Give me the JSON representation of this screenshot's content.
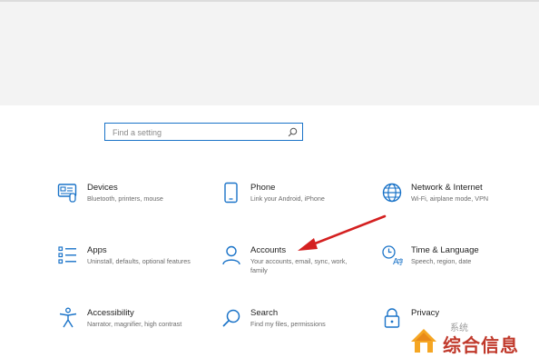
{
  "search": {
    "placeholder": "Find a setting"
  },
  "accent_color": "#1a73c8",
  "annotation_arrow_color": "#d42020",
  "tiles": [
    {
      "icon": "devices-icon",
      "title": "Devices",
      "desc": "Bluetooth, printers, mouse"
    },
    {
      "icon": "phone-icon",
      "title": "Phone",
      "desc": "Link your Android, iPhone"
    },
    {
      "icon": "globe-icon",
      "title": "Network & Internet",
      "desc": "Wi-Fi, airplane mode, VPN"
    },
    {
      "icon": "apps-list-icon",
      "title": "Apps",
      "desc": "Uninstall, defaults, optional features"
    },
    {
      "icon": "person-icon",
      "title": "Accounts",
      "desc": "Your accounts, email, sync, work, family"
    },
    {
      "icon": "time-language-icon",
      "title": "Time & Language",
      "desc": "Speech, region, date"
    },
    {
      "icon": "accessibility-icon",
      "title": "Accessibility",
      "desc": "Narrator, magnifier, high contrast"
    },
    {
      "icon": "search-icon",
      "title": "Search",
      "desc": "Find my files, permissions"
    },
    {
      "icon": "lock-icon",
      "title": "Privacy",
      "desc": ""
    }
  ],
  "watermark": {
    "faded_text": "系统",
    "text": "综合信息"
  }
}
